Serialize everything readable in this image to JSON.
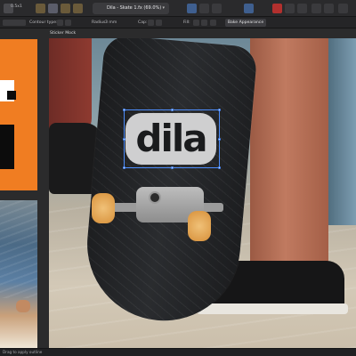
{
  "app": {
    "document_title": "Dila - Skate 1.fx (69.0%)",
    "artboard_label": "Sticker Mock",
    "status_text": "Drag to apply outline"
  },
  "toolbar": {
    "icons": [
      "persona-icon",
      "move-tool-icon",
      "align-icon",
      "arrange-icon",
      "snapping-icon",
      "view-mode-icon",
      "color-icon",
      "brush-icon",
      "layers-icon"
    ],
    "version_label": "0.5x1"
  },
  "context_bar": {
    "contour_type_label": "Contour type:",
    "radius_label": "Radius:",
    "radius_value": "3 mm",
    "cap_label": "Cap:",
    "fill_label": "Fill:",
    "bake_button": "Bake Appearance"
  },
  "canvas": {
    "sticker_text": "dila"
  },
  "colors": {
    "accent": "#4d8dfc",
    "orange_board": "#f07d22",
    "wheel": "#d7903a"
  }
}
